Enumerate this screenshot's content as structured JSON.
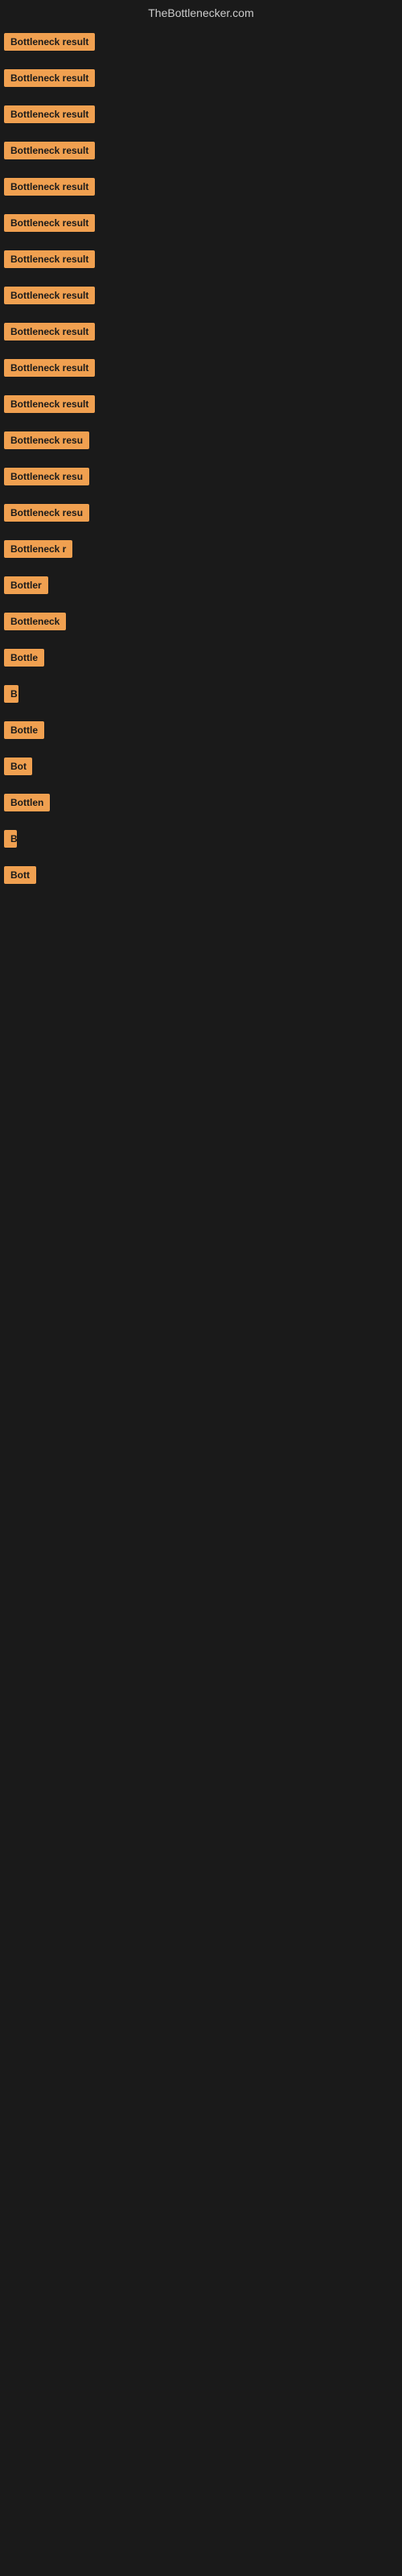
{
  "site": {
    "title": "TheBottlenecker.com"
  },
  "items": [
    {
      "id": 0,
      "label": "Bottleneck result"
    },
    {
      "id": 1,
      "label": "Bottleneck result"
    },
    {
      "id": 2,
      "label": "Bottleneck result"
    },
    {
      "id": 3,
      "label": "Bottleneck result"
    },
    {
      "id": 4,
      "label": "Bottleneck result"
    },
    {
      "id": 5,
      "label": "Bottleneck result"
    },
    {
      "id": 6,
      "label": "Bottleneck result"
    },
    {
      "id": 7,
      "label": "Bottleneck result"
    },
    {
      "id": 8,
      "label": "Bottleneck result"
    },
    {
      "id": 9,
      "label": "Bottleneck result"
    },
    {
      "id": 10,
      "label": "Bottleneck result"
    },
    {
      "id": 11,
      "label": "Bottleneck resu"
    },
    {
      "id": 12,
      "label": "Bottleneck resu"
    },
    {
      "id": 13,
      "label": "Bottleneck resu"
    },
    {
      "id": 14,
      "label": "Bottleneck r"
    },
    {
      "id": 15,
      "label": "Bottler"
    },
    {
      "id": 16,
      "label": "Bottleneck"
    },
    {
      "id": 17,
      "label": "Bottle"
    },
    {
      "id": 18,
      "label": "B"
    },
    {
      "id": 19,
      "label": "Bottle"
    },
    {
      "id": 20,
      "label": "Bot"
    },
    {
      "id": 21,
      "label": "Bottlen"
    },
    {
      "id": 22,
      "label": "B"
    },
    {
      "id": 23,
      "label": "Bott"
    }
  ]
}
